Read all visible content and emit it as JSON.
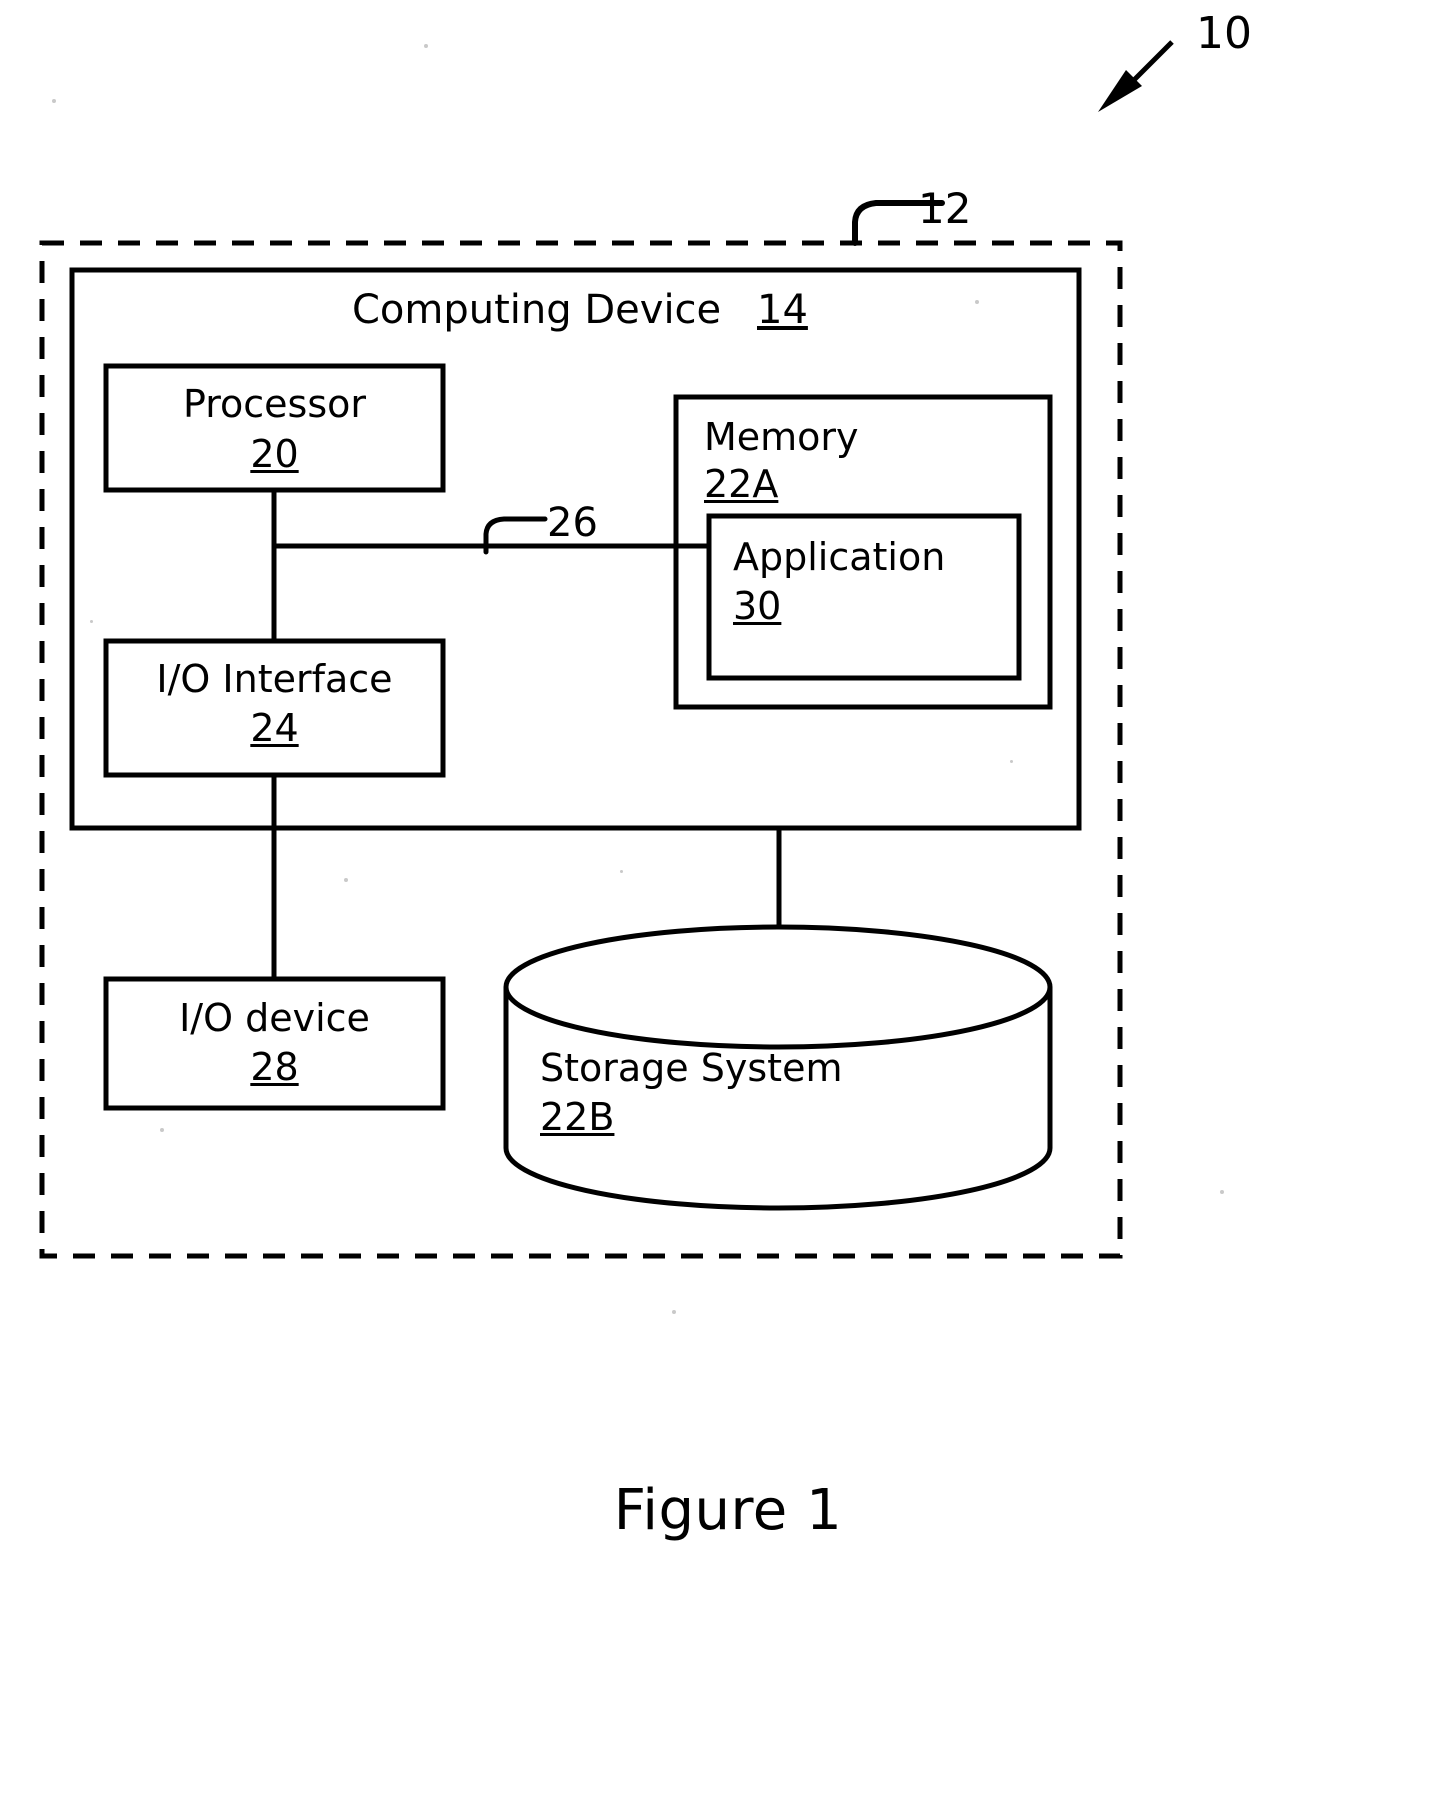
{
  "figure": {
    "caption": "Figure 1",
    "system_ref": "10",
    "environment_ref": "12",
    "bus_ref": "26"
  },
  "computing_device": {
    "title": "Computing Device",
    "ref": "14"
  },
  "blocks": {
    "processor": {
      "label": "Processor",
      "ref": "20"
    },
    "memory": {
      "label": "Memory",
      "ref": "22A"
    },
    "application": {
      "label": "Application",
      "ref": "30"
    },
    "io_interface": {
      "label": "I/O Interface",
      "ref": "24"
    },
    "io_device": {
      "label": "I/O device",
      "ref": "28"
    },
    "storage_system": {
      "label": "Storage System",
      "ref": "22B"
    }
  },
  "colors": {
    "stroke": "#000000",
    "background": "#ffffff"
  }
}
